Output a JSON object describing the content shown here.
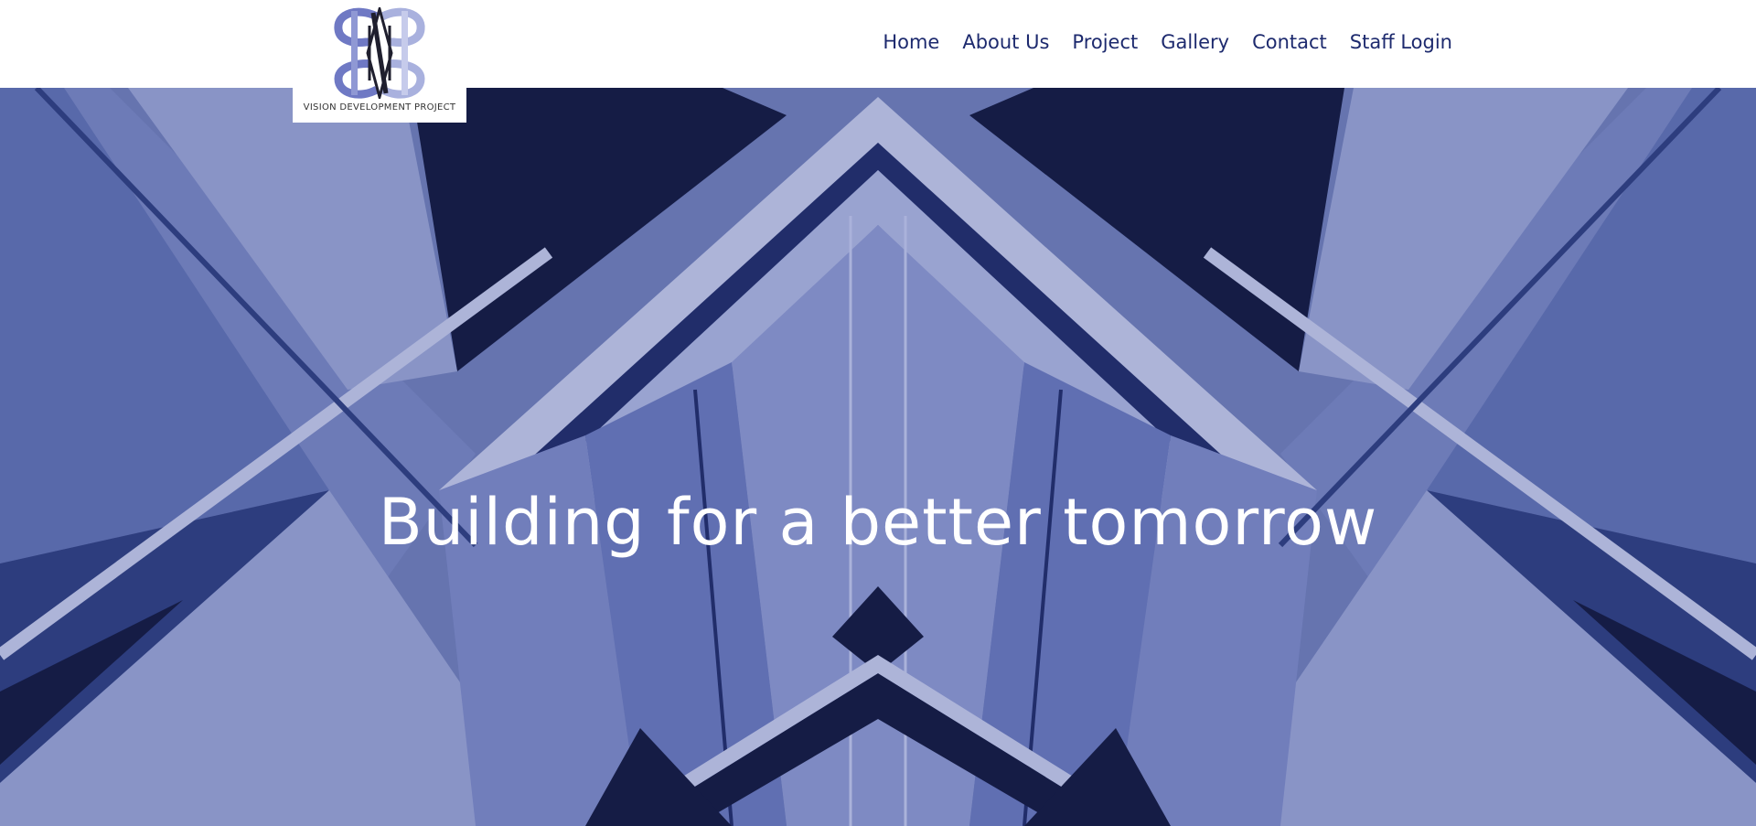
{
  "brand": {
    "name": "VISION DEVELOPMENT PROJECT",
    "logo_icon": "vdp-logo-icon",
    "colors": {
      "logo_light": "#a9b1de",
      "logo_medium": "#6f79c4",
      "logo_dark": "#1f1f2e"
    }
  },
  "nav": {
    "items": [
      {
        "label": "Home"
      },
      {
        "label": "About Us"
      },
      {
        "label": "Project"
      },
      {
        "label": "Gallery"
      },
      {
        "label": "Contact"
      },
      {
        "label": "Staff Login"
      }
    ],
    "color": "#1d2a6e"
  },
  "hero": {
    "title": "Building for a better tomorrow",
    "background": "architectural-ceiling-image",
    "colors": {
      "base": "#6f7db4",
      "light": "#9aa4d0",
      "dark": "#0d1233",
      "deep": "#2a3a78"
    }
  }
}
